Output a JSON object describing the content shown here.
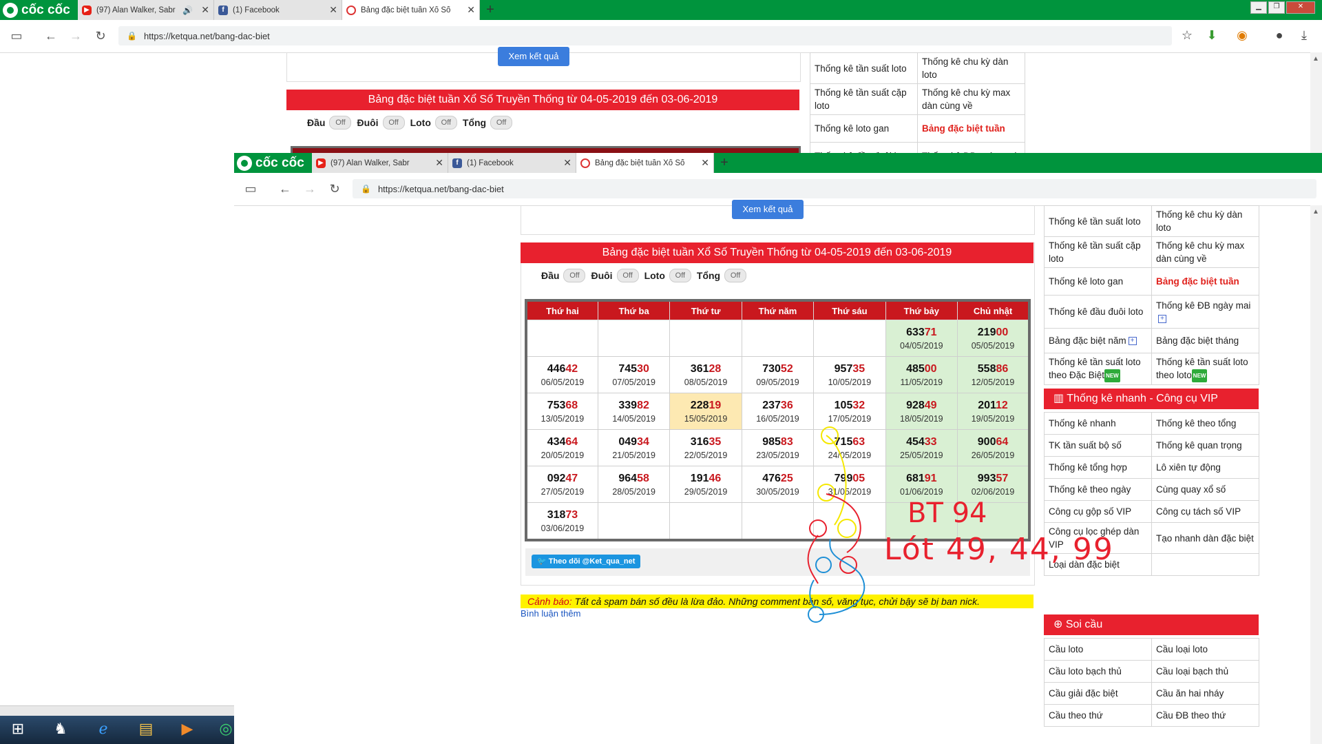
{
  "browser": {
    "logo": "cốc cốc",
    "tabs": [
      {
        "title": "(97) Alan Walker, Sabr",
        "favicon": "youtube-icon"
      },
      {
        "title": "(1) Facebook",
        "favicon": "facebook-icon"
      },
      {
        "title": "Bảng đặc biệt tuần Xổ Số",
        "favicon": "ketqua-icon"
      }
    ],
    "url": "https://ketqua.net/bang-dac-biet"
  },
  "page": {
    "view_button": "Xem kết quả",
    "table_title": "Bảng đặc biệt tuần Xổ Số Truyền Thống từ 04-05-2019 đến 03-06-2019",
    "toggles": [
      {
        "label": "Đầu",
        "state": "Off"
      },
      {
        "label": "Đuôi",
        "state": "Off"
      },
      {
        "label": "Loto",
        "state": "Off"
      },
      {
        "label": "Tổng",
        "state": "Off"
      }
    ],
    "weekdays": [
      "Thứ hai",
      "Thứ ba",
      "Thứ tư",
      "Thứ năm",
      "Thứ sáu",
      "Thứ bảy",
      "Chủ nhật"
    ],
    "rows": [
      [
        null,
        null,
        null,
        null,
        null,
        {
          "n": "63371",
          "d": "04/05/2019"
        },
        {
          "n": "21900",
          "d": "05/05/2019"
        }
      ],
      [
        {
          "n": "44642",
          "d": "06/05/2019"
        },
        {
          "n": "74530",
          "d": "07/05/2019"
        },
        {
          "n": "36128",
          "d": "08/05/2019"
        },
        {
          "n": "73052",
          "d": "09/05/2019"
        },
        {
          "n": "95735",
          "d": "10/05/2019"
        },
        {
          "n": "48500",
          "d": "11/05/2019"
        },
        {
          "n": "55886",
          "d": "12/05/2019"
        }
      ],
      [
        {
          "n": "75368",
          "d": "13/05/2019"
        },
        {
          "n": "33982",
          "d": "14/05/2019"
        },
        {
          "n": "22819",
          "d": "15/05/2019",
          "hl": true
        },
        {
          "n": "23736",
          "d": "16/05/2019"
        },
        {
          "n": "10532",
          "d": "17/05/2019"
        },
        {
          "n": "92849",
          "d": "18/05/2019"
        },
        {
          "n": "20112",
          "d": "19/05/2019"
        }
      ],
      [
        {
          "n": "43464",
          "d": "20/05/2019"
        },
        {
          "n": "04934",
          "d": "21/05/2019"
        },
        {
          "n": "31635",
          "d": "22/05/2019"
        },
        {
          "n": "98583",
          "d": "23/05/2019"
        },
        {
          "n": "71563",
          "d": "24/05/2019"
        },
        {
          "n": "45433",
          "d": "25/05/2019"
        },
        {
          "n": "90064",
          "d": "26/05/2019"
        }
      ],
      [
        {
          "n": "09247",
          "d": "27/05/2019"
        },
        {
          "n": "96458",
          "d": "28/05/2019"
        },
        {
          "n": "19146",
          "d": "29/05/2019"
        },
        {
          "n": "47625",
          "d": "30/05/2019"
        },
        {
          "n": "79905",
          "d": "31/05/2019"
        },
        {
          "n": "68191",
          "d": "01/06/2019"
        },
        {
          "n": "99357",
          "d": "02/06/2019"
        }
      ],
      [
        {
          "n": "31873",
          "d": "03/06/2019"
        },
        null,
        null,
        null,
        null,
        null,
        null
      ]
    ],
    "follow_button": "Theo dõi @Ket_qua_net",
    "warning_label": "Cảnh báo:",
    "warning_text": "Tất cả spam bán số đều là lừa đảo. Những comment bán số, văng tục, chửi bậy sẽ bị ban nick.",
    "comment_link": "Bình luận thêm",
    "handwriting": {
      "line1": "BT 94",
      "line2": "Lót 49, 44, 99"
    }
  },
  "sidebar": {
    "stats": [
      [
        "Thống kê tần suất loto",
        "Thống kê chu kỳ dàn loto"
      ],
      [
        "Thống kê tần suất cặp loto",
        "Thống kê chu kỳ max dàn cùng về"
      ],
      [
        "Thống kê loto gan",
        "Bảng đặc biệt tuần"
      ],
      [
        "Thống kê đầu đuôi loto",
        "Thống kê ĐB ngày mai"
      ],
      [
        "Bảng đặc biệt năm",
        "Bảng đặc biệt tháng"
      ],
      [
        "Thống kê tần suất loto theo Đặc Biệt",
        "Thống kê tần suất loto theo loto"
      ]
    ],
    "new_badge": "NEW",
    "vip_title": "Thống kê nhanh - Công cụ VIP",
    "vip": [
      [
        "Thống kê nhanh",
        "Thống kê theo tổng"
      ],
      [
        "TK tần suất bộ số",
        "Thống kê quan trọng"
      ],
      [
        "Thống kê tổng hợp",
        "Lô xiên tự động"
      ],
      [
        "Thống kê theo ngày",
        "Cùng quay xổ số"
      ],
      [
        "Công cụ gộp số VIP",
        "Công cụ tách số VIP"
      ],
      [
        "Công cụ lọc ghép dàn VIP",
        "Tạo nhanh dàn đặc biệt"
      ],
      [
        "Loại dàn đặc biệt",
        ""
      ]
    ],
    "soi_title": "Soi cầu",
    "soi": [
      [
        "Cầu loto",
        "Cầu loại loto"
      ],
      [
        "Cầu loto bạch thủ",
        "Cầu loại bạch thủ"
      ],
      [
        "Cầu giải đặc biệt",
        "Cầu ăn hai nháy"
      ],
      [
        "Cầu theo thứ",
        "Cầu ĐB theo thứ"
      ]
    ]
  },
  "colors": {
    "accent_red": "#e8212e",
    "header_red": "#c9181e",
    "coccoc_green": "#00943d",
    "weekend_green": "#d9f0d3"
  }
}
